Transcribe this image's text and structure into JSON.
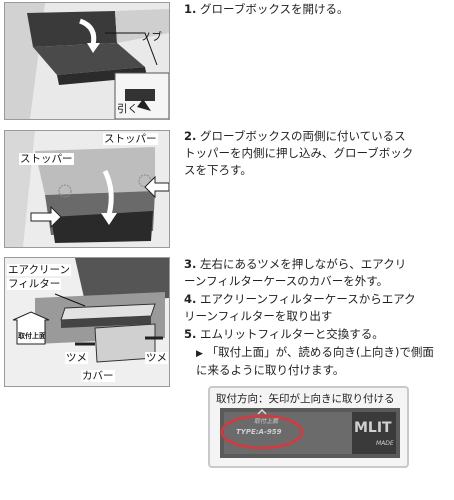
{
  "steps": [
    {
      "num": "1.",
      "text": "グローブボックスを開ける。"
    },
    {
      "num": "2.",
      "text": "グローブボックスの両側に付いているストッパーを内側に押し込み、グローブボックスを下ろす。"
    },
    {
      "num": "3.",
      "text": "左右にあるツメを押しながら、エアクリーンフィルターケースのカバーを外す。"
    },
    {
      "num": "4.",
      "text": "エアクリーンフィルターケースからエアクリーンフィルターを取り出す"
    },
    {
      "num": "5.",
      "text": "エムリットフィルターと交換する。"
    }
  ],
  "note": {
    "bullet": "▶",
    "text": "「取付上面」が、読める向き(上向き)で側面に来るように取り付けます。"
  },
  "figure1": {
    "knob_label": "ノブ",
    "pull_label": "引く"
  },
  "figure2": {
    "stopper_left": "ストッパー",
    "stopper_right": "ストッパー"
  },
  "figure3": {
    "filter_label_1": "エアクリーン",
    "filter_label_2": "フィルター",
    "top_side_label": "取付上面",
    "claw_left": "ツメ",
    "claw_right": "ツメ",
    "cover_label": "カバー"
  },
  "photo": {
    "caption": "取付方向：矢印が上向きに取り付ける",
    "top_mark": "取付上面",
    "model": "TYPE:A-959",
    "brand": "MLIT",
    "made": "MADE",
    "circle_color": "#d9363e"
  }
}
